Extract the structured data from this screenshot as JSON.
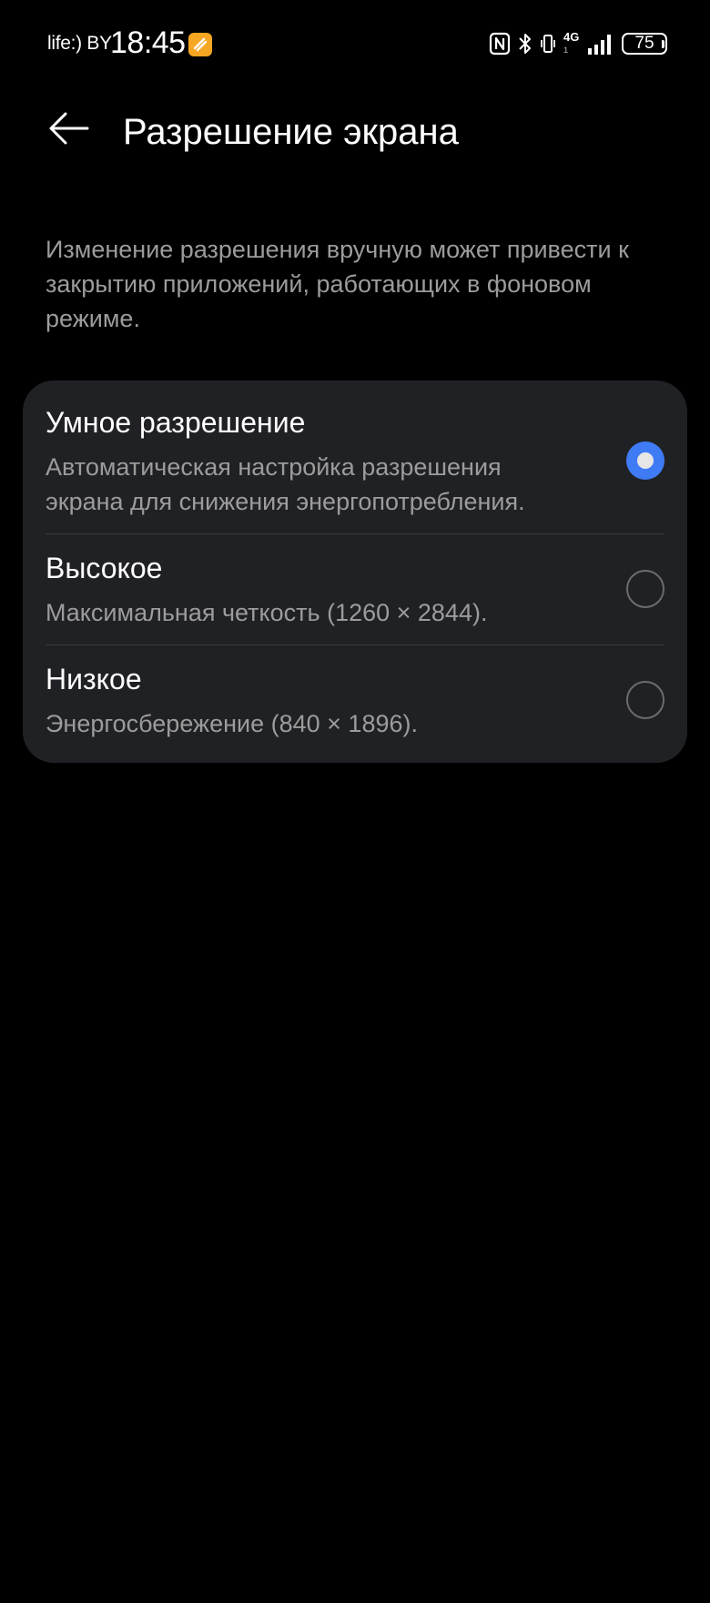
{
  "status_bar": {
    "carrier": "life:) BY",
    "time": "18:45",
    "network": "4G",
    "network_sub": "1",
    "battery": "75"
  },
  "header": {
    "title": "Разрешение экрана"
  },
  "description": "Изменение разрешения вручную может привести к закрытию приложений, работающих в фоновом режиме.",
  "options": [
    {
      "title": "Умное разрешение",
      "description": "Автоматическая настройка разрешения экрана для снижения энергопотребления.",
      "selected": true
    },
    {
      "title": "Высокое",
      "description": "Максимальная четкость (1260 × 2844).",
      "selected": false
    },
    {
      "title": "Низкое",
      "description": "Энергосбережение (840 × 1896).",
      "selected": false
    }
  ],
  "colors": {
    "accent": "#3f7bf4",
    "card_background": "#202124",
    "secondary_text": "#9c9c9c"
  }
}
